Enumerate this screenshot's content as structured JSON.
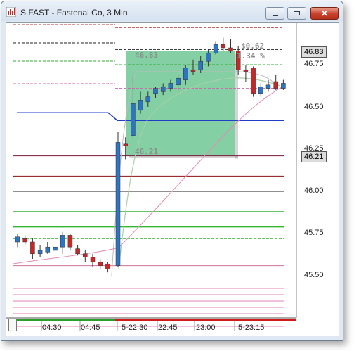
{
  "window": {
    "title": "S.FAST - Fastenal Co, 3 Min",
    "icon": "chart-app-icon",
    "controls": [
      "minimize",
      "maximize",
      "close"
    ],
    "close_glyph": "✕"
  },
  "price_axis": {
    "ticks": [
      "46.75",
      "46.50",
      "46.25",
      "46.00",
      "45.75",
      "45.50"
    ],
    "tags": [
      "46.83",
      "46.21"
    ]
  },
  "time_axis": {
    "ticks": [
      "04:30",
      "04:45",
      "5-22:30",
      "22:45",
      "23:00",
      "5-23:15"
    ]
  },
  "measure_box": {
    "high_label": "46.83",
    "low_label": "46.21",
    "change_label": "$0.62",
    "percent_label": "1.34 %"
  },
  "colors": {
    "up_candle": "#2e74c4",
    "down_candle": "#c62828",
    "measure_fill": "#5bbf86",
    "blue_line": "#1f3fc8",
    "timebar_green": "#2aa02a",
    "timebar_red": "#d21a1a"
  },
  "chart_data": {
    "type": "candlestick",
    "symbol": "S.FAST",
    "interval": "3 Min",
    "y_range": [
      45.35,
      47.05
    ],
    "candles_session1": [
      {
        "o": 45.7,
        "h": 45.75,
        "l": 45.67,
        "c": 45.73
      },
      {
        "o": 45.72,
        "h": 45.74,
        "l": 45.68,
        "c": 45.7
      },
      {
        "o": 45.7,
        "h": 45.72,
        "l": 45.6,
        "c": 45.63
      },
      {
        "o": 45.63,
        "h": 45.68,
        "l": 45.61,
        "c": 45.65
      },
      {
        "o": 45.64,
        "h": 45.7,
        "l": 45.63,
        "c": 45.67
      },
      {
        "o": 45.65,
        "h": 45.69,
        "l": 45.63,
        "c": 45.67
      },
      {
        "o": 45.67,
        "h": 45.76,
        "l": 45.63,
        "c": 45.74
      },
      {
        "o": 45.74,
        "h": 45.75,
        "l": 45.65,
        "c": 45.67
      },
      {
        "o": 45.66,
        "h": 45.68,
        "l": 45.62,
        "c": 45.63
      },
      {
        "o": 45.63,
        "h": 45.65,
        "l": 45.58,
        "c": 45.61
      },
      {
        "o": 45.61,
        "h": 45.63,
        "l": 45.55,
        "c": 45.58
      },
      {
        "o": 45.58,
        "h": 45.6,
        "l": 45.54,
        "c": 45.56
      },
      {
        "o": 45.57,
        "h": 45.58,
        "l": 45.52,
        "c": 45.54
      }
    ],
    "candles_session2": [
      {
        "o": 45.56,
        "h": 46.35,
        "l": 45.55,
        "c": 46.29
      },
      {
        "o": 46.28,
        "h": 46.32,
        "l": 46.19,
        "c": 46.27
      },
      {
        "o": 46.33,
        "h": 46.68,
        "l": 46.31,
        "c": 46.52
      },
      {
        "o": 46.48,
        "h": 46.59,
        "l": 46.46,
        "c": 46.54
      },
      {
        "o": 46.53,
        "h": 46.59,
        "l": 46.5,
        "c": 46.56
      },
      {
        "o": 46.58,
        "h": 46.62,
        "l": 46.55,
        "c": 46.61
      },
      {
        "o": 46.59,
        "h": 46.64,
        "l": 46.57,
        "c": 46.62
      },
      {
        "o": 46.61,
        "h": 46.66,
        "l": 46.59,
        "c": 46.64
      },
      {
        "o": 46.63,
        "h": 46.69,
        "l": 46.6,
        "c": 46.67
      },
      {
        "o": 46.66,
        "h": 46.75,
        "l": 46.63,
        "c": 46.73
      },
      {
        "o": 46.72,
        "h": 46.78,
        "l": 46.69,
        "c": 46.71
      },
      {
        "o": 46.72,
        "h": 46.8,
        "l": 46.7,
        "c": 46.77
      },
      {
        "o": 46.77,
        "h": 46.84,
        "l": 46.74,
        "c": 46.82
      },
      {
        "o": 46.82,
        "h": 46.89,
        "l": 46.81,
        "c": 46.87
      },
      {
        "o": 46.87,
        "h": 46.91,
        "l": 46.83,
        "c": 46.85
      },
      {
        "o": 46.85,
        "h": 46.9,
        "l": 46.82,
        "c": 46.83
      },
      {
        "o": 46.83,
        "h": 46.86,
        "l": 46.69,
        "c": 46.72
      },
      {
        "o": 46.72,
        "h": 46.75,
        "l": 46.65,
        "c": 46.71
      },
      {
        "o": 46.73,
        "h": 46.74,
        "l": 46.56,
        "c": 46.58
      },
      {
        "o": 46.58,
        "h": 46.64,
        "l": 46.56,
        "c": 46.62
      },
      {
        "o": 46.61,
        "h": 46.66,
        "l": 46.59,
        "c": 46.63
      },
      {
        "o": 46.65,
        "h": 46.69,
        "l": 46.6,
        "c": 46.61
      },
      {
        "o": 46.61,
        "h": 46.66,
        "l": 46.6,
        "c": 46.64
      }
    ],
    "levels": [
      {
        "name": "blue",
        "price": 46.42,
        "color": "#1f3fc8",
        "style": "solid"
      },
      {
        "name": "maroon",
        "price": 46.21,
        "color": "#7a1a3a",
        "style": "solid"
      },
      {
        "name": "dark-red",
        "price": 46.09,
        "color": "#8b1010",
        "style": "solid"
      },
      {
        "name": "black",
        "price": 46.0,
        "color": "#222222",
        "style": "solid"
      },
      {
        "name": "green1",
        "price": 45.88,
        "color": "#34b034",
        "style": "solid"
      },
      {
        "name": "green2",
        "price": 45.79,
        "color": "#2fb82f",
        "style": "dashed"
      },
      {
        "name": "green3",
        "price": 45.72,
        "color": "#34b034",
        "style": "dashed"
      },
      {
        "name": "pink",
        "price": 45.56,
        "color": "#d070a0",
        "style": "solid"
      }
    ],
    "dashed_top_levels": [
      {
        "price": 46.97,
        "color": "#b03030"
      },
      {
        "price": 46.84,
        "color": "#222222"
      },
      {
        "price": 46.75,
        "color": "#33aa33"
      },
      {
        "price": 46.61,
        "color": "#cc66aa"
      }
    ],
    "pink_bottom_levels": [
      45.45,
      45.4,
      45.35,
      45.3,
      45.28,
      45.24,
      45.22
    ]
  }
}
